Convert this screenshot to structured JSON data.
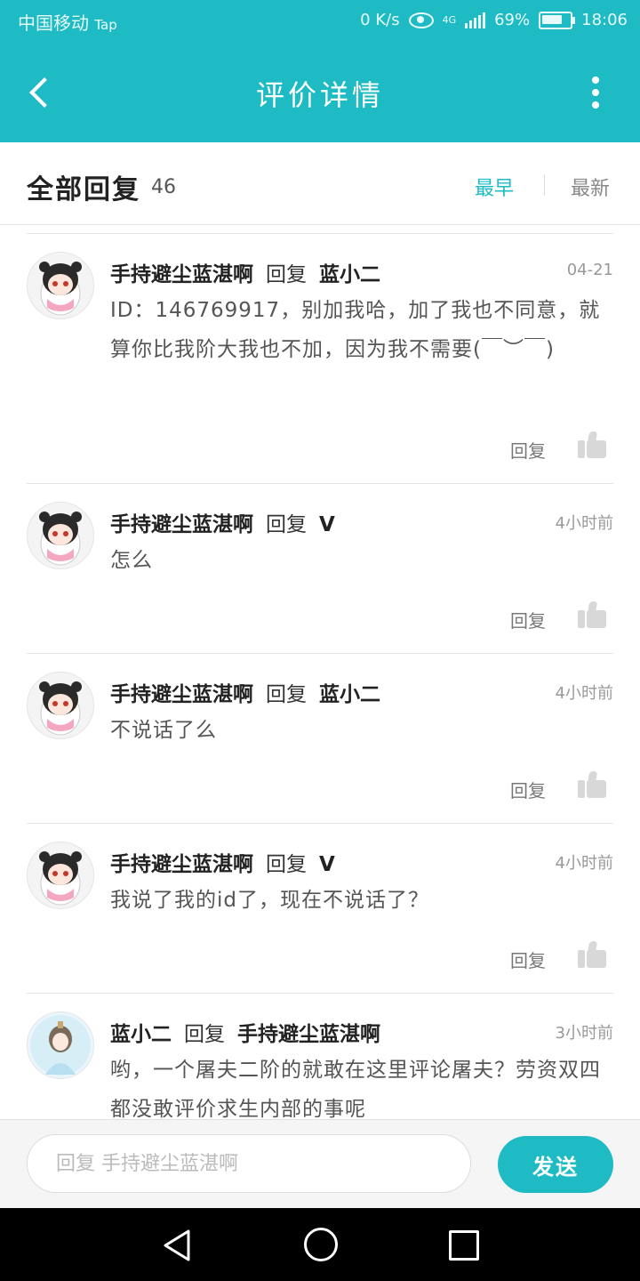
{
  "status_bar": {
    "carrier": "中国移动",
    "carrier_app": "Tap",
    "net_speed": "0 K/s",
    "network": "4G",
    "battery": "69%",
    "time": "18:06"
  },
  "app_bar": {
    "title": "评价详情",
    "back_icon": "back-arrow-icon",
    "more_icon": "more-vertical-icon"
  },
  "replies_header": {
    "label": "全部回复",
    "count": "46",
    "sort_earliest": "最早",
    "sort_newest": "最新",
    "active_sort": "earliest"
  },
  "reply_action_label": "回复",
  "comments": [
    {
      "author": "手持避尘蓝湛啊",
      "reply_word": "回复",
      "target": "蓝小二",
      "time": "04-21",
      "content": "ID：146769917，别加我哈，加了我也不同意，就算你比我阶大我也不加，因为我不需要(￣︶￣)"
    },
    {
      "author": "手持避尘蓝湛啊",
      "reply_word": "回复",
      "target": "V",
      "time": "4小时前",
      "content": "怎么"
    },
    {
      "author": "手持避尘蓝湛啊",
      "reply_word": "回复",
      "target": "蓝小二",
      "time": "4小时前",
      "content": "不说话了么"
    },
    {
      "author": "手持避尘蓝湛啊",
      "reply_word": "回复",
      "target": "V",
      "time": "4小时前",
      "content": "我说了我的id了，现在不说话了？"
    },
    {
      "author": "蓝小二",
      "reply_word": "回复",
      "target": "手持避尘蓝湛啊",
      "time": "3小时前",
      "content": "哟，一个屠夫二阶的就敢在这里评论屠夫？劳资双四都没敢评价求生内部的事呢"
    }
  ],
  "input_bar": {
    "placeholder": "回复 手持避尘蓝湛啊",
    "send_label": "发送"
  },
  "colors": {
    "accent": "#1ebbc5",
    "text_dark": "#222222",
    "text_muted": "#999999"
  }
}
